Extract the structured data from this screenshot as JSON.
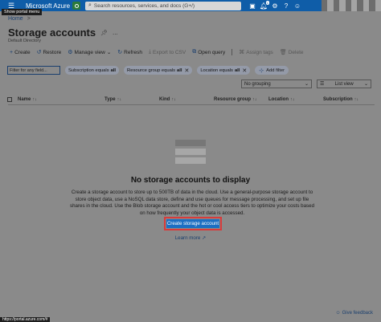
{
  "topbar": {
    "menu_icon": "hamburger-icon",
    "brand": "Microsoft Azure",
    "search_placeholder": "Search resources, services, and docs (G+/)",
    "icons": [
      "cloud-shell-icon",
      "notifications-icon",
      "settings-icon",
      "help-icon",
      "feedback-icon"
    ],
    "notification_count": "1",
    "tooltip": "Show portal menu"
  },
  "breadcrumb": {
    "home": "Home",
    "separator": ">"
  },
  "page": {
    "title": "Storage accounts",
    "subtitle": "Default Directory",
    "more": "..."
  },
  "toolbar": {
    "create": "Create",
    "restore": "Restore",
    "manage_view": "Manage view",
    "refresh": "Refresh",
    "export": "Export to CSV",
    "open_query": "Open query",
    "assign_tags": "Assign tags",
    "delete": "Delete"
  },
  "filters": {
    "input_placeholder": "Filter for any field...",
    "pills": [
      {
        "label": "Subscription equals",
        "value": "all"
      },
      {
        "label": "Resource group equals",
        "value": "all"
      },
      {
        "label": "Location equals",
        "value": "all"
      }
    ],
    "add_filter": "Add filter"
  },
  "view": {
    "grouping": "No grouping",
    "view_mode": "List view"
  },
  "columns": [
    "Name",
    "Type",
    "Kind",
    "Resource group",
    "Location",
    "Subscription"
  ],
  "empty_state": {
    "title": "No storage accounts to display",
    "description": "Create a storage account to store up to 500TB of data in the cloud. Use a general-purpose storage account to store object data, use a NoSQL data store, define and use queues for message processing, and set up file shares in the cloud. Use the Blob storage account and the hot or cool access tiers to optimize your costs based on how frequently your object data is accessed.",
    "create_button": "Create storage account",
    "learn_more": "Learn more"
  },
  "footer": {
    "feedback": "Give feedback",
    "status_url": "https://portal.azure.com/#"
  },
  "colors": {
    "topbar": "#0f5da8",
    "primary_button": "#1c6fc2",
    "highlight_border": "#d83b3b",
    "link": "#1a3f6e"
  }
}
